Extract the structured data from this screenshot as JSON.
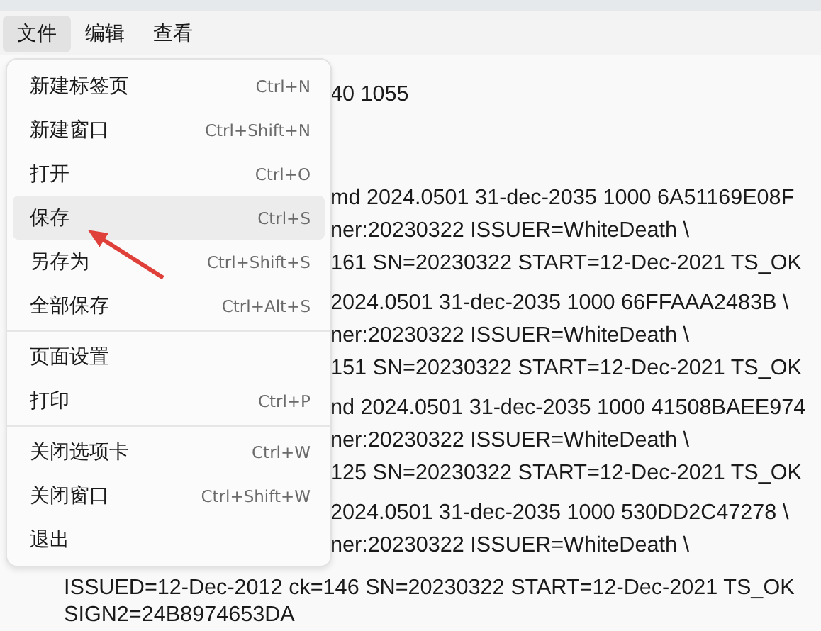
{
  "menubar": [
    {
      "label": "文件",
      "selected": true
    },
    {
      "label": "编辑",
      "selected": false
    },
    {
      "label": "查看",
      "selected": false
    }
  ],
  "editor_blocks": [
    [
      {
        "kind": "partial",
        "text": "40 1055"
      }
    ],
    [
      {
        "kind": "partial",
        "text": "md 2024.0501 31-dec-2035 1000 6A51169E08F"
      },
      {
        "kind": "partial",
        "text": "ner:20230322 ISSUER=WhiteDeath \\"
      },
      {
        "kind": "partial",
        "text": "161 SN=20230322 START=12-Dec-2021 TS_OK"
      }
    ],
    [
      {
        "kind": "partial",
        "text": "2024.0501 31-dec-2035 1000 66FFAAA2483B \\"
      },
      {
        "kind": "partial",
        "text": "ner:20230322 ISSUER=WhiteDeath \\"
      },
      {
        "kind": "partial",
        "text": "151 SN=20230322 START=12-Dec-2021 TS_OK"
      }
    ],
    [
      {
        "kind": "partial",
        "text": "nd 2024.0501 31-dec-2035 1000 41508BAEE974"
      },
      {
        "kind": "partial",
        "text": "ner:20230322 ISSUER=WhiteDeath \\"
      },
      {
        "kind": "partial",
        "text": "125 SN=20230322 START=12-Dec-2021 TS_OK"
      }
    ],
    [
      {
        "kind": "partial",
        "text": "2024.0501 31-dec-2035 1000 530DD2C47278 \\"
      },
      {
        "kind": "partial",
        "text": "ner:20230322 ISSUER=WhiteDeath \\"
      },
      {
        "kind": "whole",
        "text": "ISSUED=12-Dec-2012 ck=146 SN=20230322 START=12-Dec-2021 TS_OK"
      },
      {
        "kind": "whole",
        "text": "SIGN2=24B8974653DA"
      }
    ]
  ],
  "file_menu": {
    "groups": [
      [
        {
          "label": "新建标签页",
          "shortcut": "Ctrl+N",
          "selected": false
        },
        {
          "label": "新建窗口",
          "shortcut": "Ctrl+Shift+N",
          "selected": false
        },
        {
          "label": "打开",
          "shortcut": "Ctrl+O",
          "selected": false
        },
        {
          "label": "保存",
          "shortcut": "Ctrl+S",
          "selected": true
        },
        {
          "label": "另存为",
          "shortcut": "Ctrl+Shift+S",
          "selected": false
        },
        {
          "label": "全部保存",
          "shortcut": "Ctrl+Alt+S",
          "selected": false
        }
      ],
      [
        {
          "label": "页面设置",
          "selected": false
        },
        {
          "label": "打印",
          "shortcut": "Ctrl+P",
          "selected": false
        }
      ],
      [
        {
          "label": "关闭选项卡",
          "shortcut": "Ctrl+W",
          "selected": false
        },
        {
          "label": "关闭窗口",
          "shortcut": "Ctrl+Shift+W",
          "selected": false
        },
        {
          "label": "退出",
          "selected": false
        }
      ]
    ]
  }
}
